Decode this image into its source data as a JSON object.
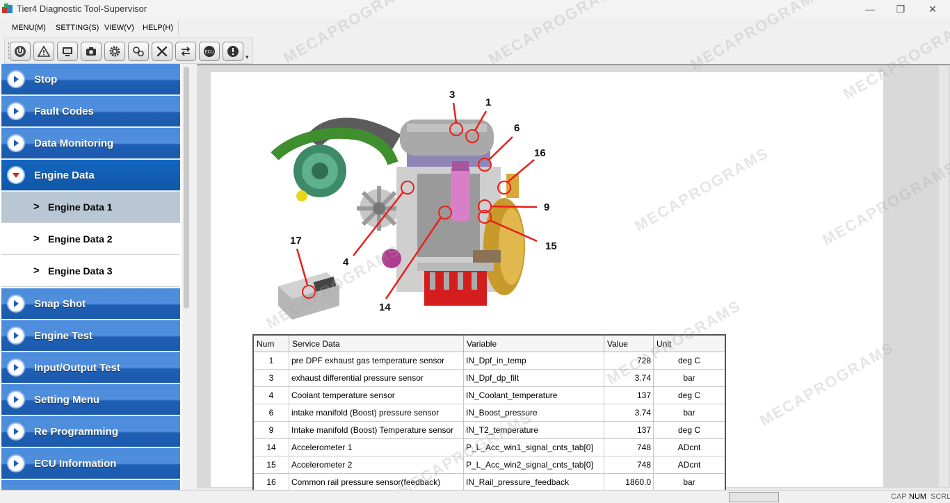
{
  "window": {
    "title": "Tier4 Diagnostic Tool-Supervisor",
    "minimize_glyph": "—",
    "maximize_glyph": "❐",
    "close_glyph": "✕"
  },
  "menu": [
    {
      "label": "MENU(M)"
    },
    {
      "label": "SETTING(S)"
    },
    {
      "label": "VIEW(V)"
    },
    {
      "label": "HELP(H)"
    }
  ],
  "toolbar": {
    "buttons": [
      {
        "icon": "power-icon"
      },
      {
        "icon": "warning-icon"
      },
      {
        "icon": "monitor-icon"
      },
      {
        "icon": "camera-icon"
      },
      {
        "icon": "gear-icon"
      },
      {
        "icon": "gears-icon"
      },
      {
        "icon": "tools-icon"
      },
      {
        "icon": "transfer-icon"
      },
      {
        "icon": "ecu-icon",
        "text": "ECU"
      },
      {
        "icon": "alert-icon"
      }
    ]
  },
  "sidebar": {
    "items": [
      {
        "label": "Stop"
      },
      {
        "label": "Fault Codes"
      },
      {
        "label": "Data Monitoring"
      },
      {
        "label": "Engine Data",
        "expanded": true
      },
      {
        "label": "Snap Shot"
      },
      {
        "label": "Engine Test"
      },
      {
        "label": "Input/Output Test"
      },
      {
        "label": "Setting Menu"
      },
      {
        "label": "Re Programming"
      },
      {
        "label": "ECU Information"
      }
    ],
    "sub_items": [
      {
        "label": "Engine Data 1",
        "selected": true
      },
      {
        "label": "Engine Data 2"
      },
      {
        "label": "Engine Data 3"
      }
    ],
    "chevron": ">"
  },
  "figure": {
    "callouts": [
      "3",
      "1",
      "6",
      "16",
      "9",
      "15",
      "4",
      "14",
      "17"
    ]
  },
  "table": {
    "headers": [
      "Num",
      "Service Data",
      "Variable",
      "Value",
      "Unit"
    ],
    "rows": [
      [
        "1",
        "pre DPF exhaust gas temperature sensor",
        "IN_Dpf_in_temp",
        "728",
        "deg C"
      ],
      [
        "3",
        "exhaust differential pressure sensor",
        "IN_Dpf_dp_filt",
        "3.74",
        "bar"
      ],
      [
        "4",
        "Coolant temperature sensor",
        "IN_Coolant_temperature",
        "137",
        "deg C"
      ],
      [
        "6",
        "intake manifold (Boost) pressure sensor",
        "IN_Boost_pressure",
        "3.74",
        "bar"
      ],
      [
        "9",
        "Intake manifold (Boost) Temperature sensor",
        "IN_T2_temperature",
        "137",
        "deg C"
      ],
      [
        "14",
        "Accelerometer 1",
        "P_L_Acc_win1_signal_cnts_tab[0]",
        "748",
        "ADcnt"
      ],
      [
        "15",
        "Accelerometer 2",
        "P_L_Acc_win2_signal_cnts_tab[0]",
        "748",
        "ADcnt"
      ],
      [
        "16",
        "Common rail pressure sensor(feedback)",
        "IN_Rail_pressure_feedback",
        "1860.0",
        "bar"
      ]
    ]
  },
  "status": {
    "indicators": [
      {
        "label": "CAP",
        "on": false
      },
      {
        "label": "NUM",
        "on": true
      },
      {
        "label": "SCRL",
        "on": false
      }
    ]
  },
  "watermark": {
    "text": "MECAPROGRAMS"
  },
  "colors": {
    "nav_blue": "#1e5fb4",
    "nav_active": "#1566c0",
    "subitem_selected": "#b9c7d4",
    "callout_red": "#e8201a"
  }
}
